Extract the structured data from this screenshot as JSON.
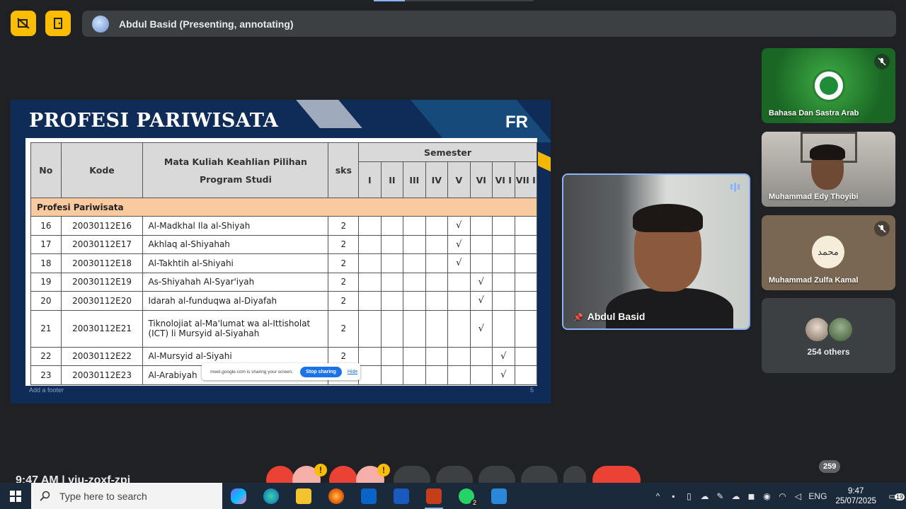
{
  "meet": {
    "presenter_label": "Abdul Basid (Presenting, annotating)",
    "time": "9:47 AM",
    "meeting_code": "yiu-zoxf-zpi",
    "participant_count": "259",
    "warn_glyph": "!"
  },
  "slide": {
    "title": "PROFESI PARIWISATA",
    "tag": "FR",
    "footer": "Add a footer",
    "page_num": "5",
    "table": {
      "headers": {
        "no": "No",
        "kode": "Kode",
        "mata_kuliah_line1": "Mata Kuliah Keahlian Pilihan",
        "mata_kuliah_line2": "Program Studi",
        "sks": "sks",
        "semester": "Semester",
        "semesters": [
          "I",
          "II",
          "III",
          "IV",
          "V",
          "VI",
          "VI I",
          "VII I"
        ]
      },
      "section": "Profesi Pariwisata",
      "rows": [
        {
          "no": "16",
          "kode": "20030112E16",
          "mk": "Al-Madkhal Ila al-Shiyah",
          "sks": "2",
          "sem": 5
        },
        {
          "no": "17",
          "kode": "20030112E17",
          "mk": "Akhlaq al-Shiyahah",
          "sks": "2",
          "sem": 5
        },
        {
          "no": "18",
          "kode": "20030112E18",
          "mk": "Al-Takhtih al-Shiyahi",
          "sks": "2",
          "sem": 5
        },
        {
          "no": "19",
          "kode": "20030112E19",
          "mk": "As-Shiyahah Al-Syar'iyah",
          "sks": "2",
          "sem": 6
        },
        {
          "no": "20",
          "kode": "20030112E20",
          "mk": "Idarah al-funduqwa al-Diyafah",
          "sks": "2",
          "sem": 6
        },
        {
          "no": "21",
          "kode": "20030112E21",
          "mk": "Tiknolojiat al-Ma'lumat wa al-Ittisholat (ICT) li Mursyid al-Siyahah",
          "sks": "2",
          "sem": 6
        },
        {
          "no": "22",
          "kode": "20030112E22",
          "mk": "Al-Mursyid al-Siyahi",
          "sks": "2",
          "sem": 7
        },
        {
          "no": "23",
          "kode": "20030112E23",
          "mk": "Al-Arabiyah",
          "sks": "2",
          "sem": 7
        }
      ],
      "check": "√"
    }
  },
  "share_bar": {
    "text": "meet.google.com is sharing your screen.",
    "stop": "Stop sharing",
    "hide": "Hide"
  },
  "tiles": {
    "main": "Abdul Basid",
    "t1": "Bahasa Dan Sastra Arab",
    "t2": "Muhammad Edy Thoyibi",
    "t3": "Muhammad Zulfa Kamal",
    "t3_logo_text": "محمد",
    "t4": "254 others"
  },
  "taskbar": {
    "search_placeholder": "Type here to search",
    "whatsapp_count": "2",
    "lang": "ENG",
    "time": "9:47",
    "date": "25/07/2025",
    "notifications": "19"
  },
  "colors": {
    "meet_bg": "#202124",
    "accent_yellow": "#fbbc04",
    "end_call_red": "#ea4335",
    "slide_navy": "#0f2b57",
    "section_peach": "#f9c9a0"
  }
}
